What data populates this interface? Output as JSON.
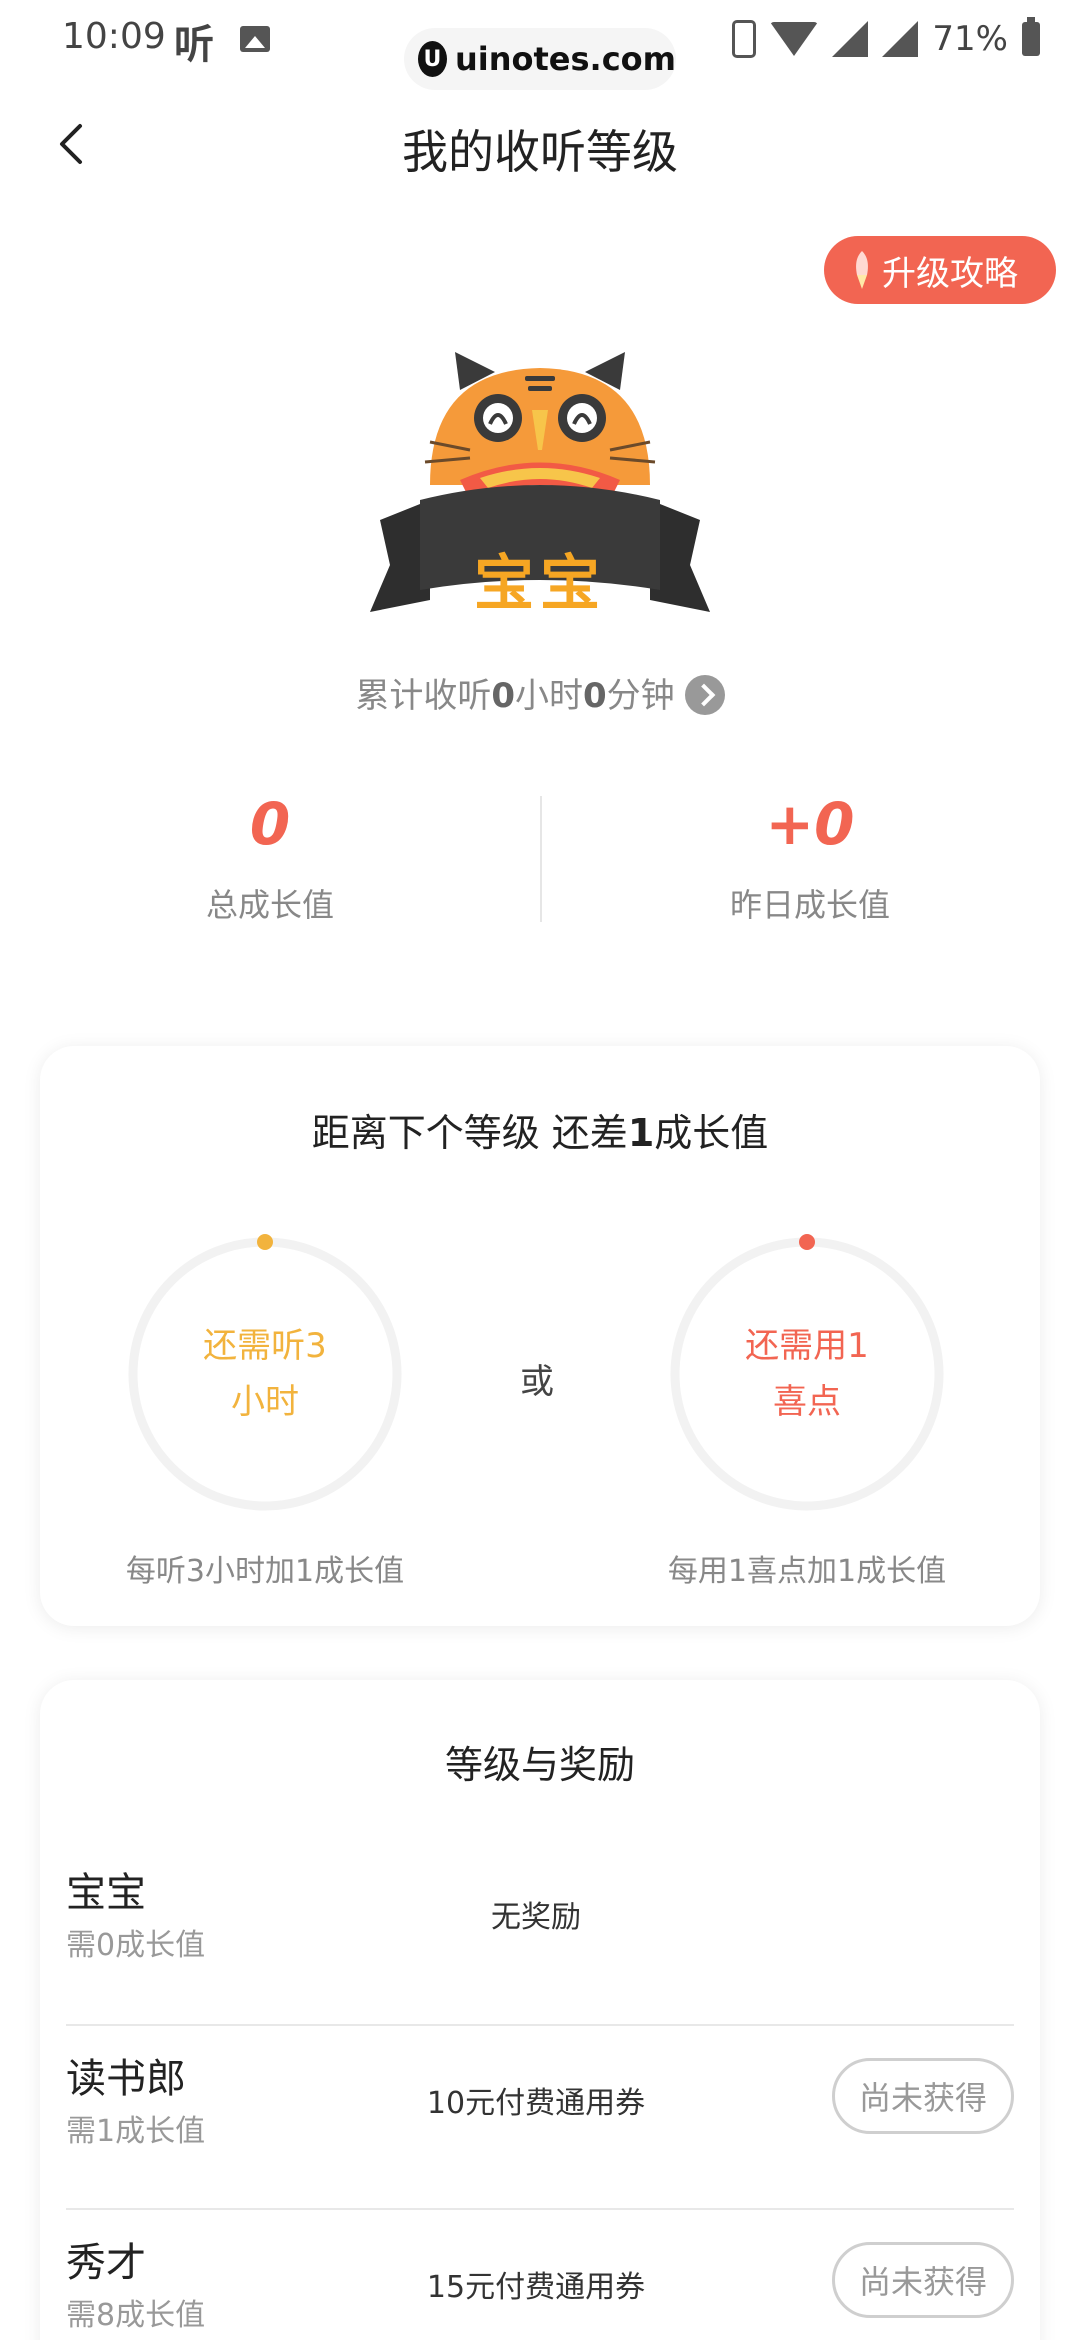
{
  "status_bar": {
    "time": "10:09",
    "app_glyph": "听",
    "watermark": "uinotes.com",
    "battery": "71%"
  },
  "header": {
    "title": "我的收听等级"
  },
  "strategy_button": {
    "label": "升级攻略"
  },
  "badge": {
    "level_name": "宝宝"
  },
  "listen_total": {
    "prefix": "累计收听",
    "hours": "0",
    "hours_unit": "小时",
    "minutes": "0",
    "minutes_unit": "分钟"
  },
  "stats": {
    "total_value": "0",
    "total_label": "总成长值",
    "yesterday_value": "+0",
    "yesterday_label": "昨日成长值"
  },
  "progress_card": {
    "title_prefix": "距离下个等级 还差",
    "title_number": "1",
    "title_suffix": "成长值",
    "or_text": "或",
    "listen": {
      "line1": "还需听3",
      "line2": "小时",
      "caption": "每听3小时加1成长值",
      "color": "#f2b33d"
    },
    "xidian": {
      "line1": "还需用1",
      "line2": "喜点",
      "caption": "每用1喜点加1成长值",
      "color": "#f26552"
    }
  },
  "rewards_card": {
    "title": "等级与奖励",
    "rows": [
      {
        "level": "宝宝",
        "need": "需0成长值",
        "reward": "无奖励",
        "status": ""
      },
      {
        "level": "读书郎",
        "need": "需1成长值",
        "reward": "10元付费通用券",
        "status": "尚未获得"
      },
      {
        "level": "秀才",
        "need": "需8成长值",
        "reward": "15元付费通用券",
        "status": "尚未获得"
      }
    ]
  }
}
